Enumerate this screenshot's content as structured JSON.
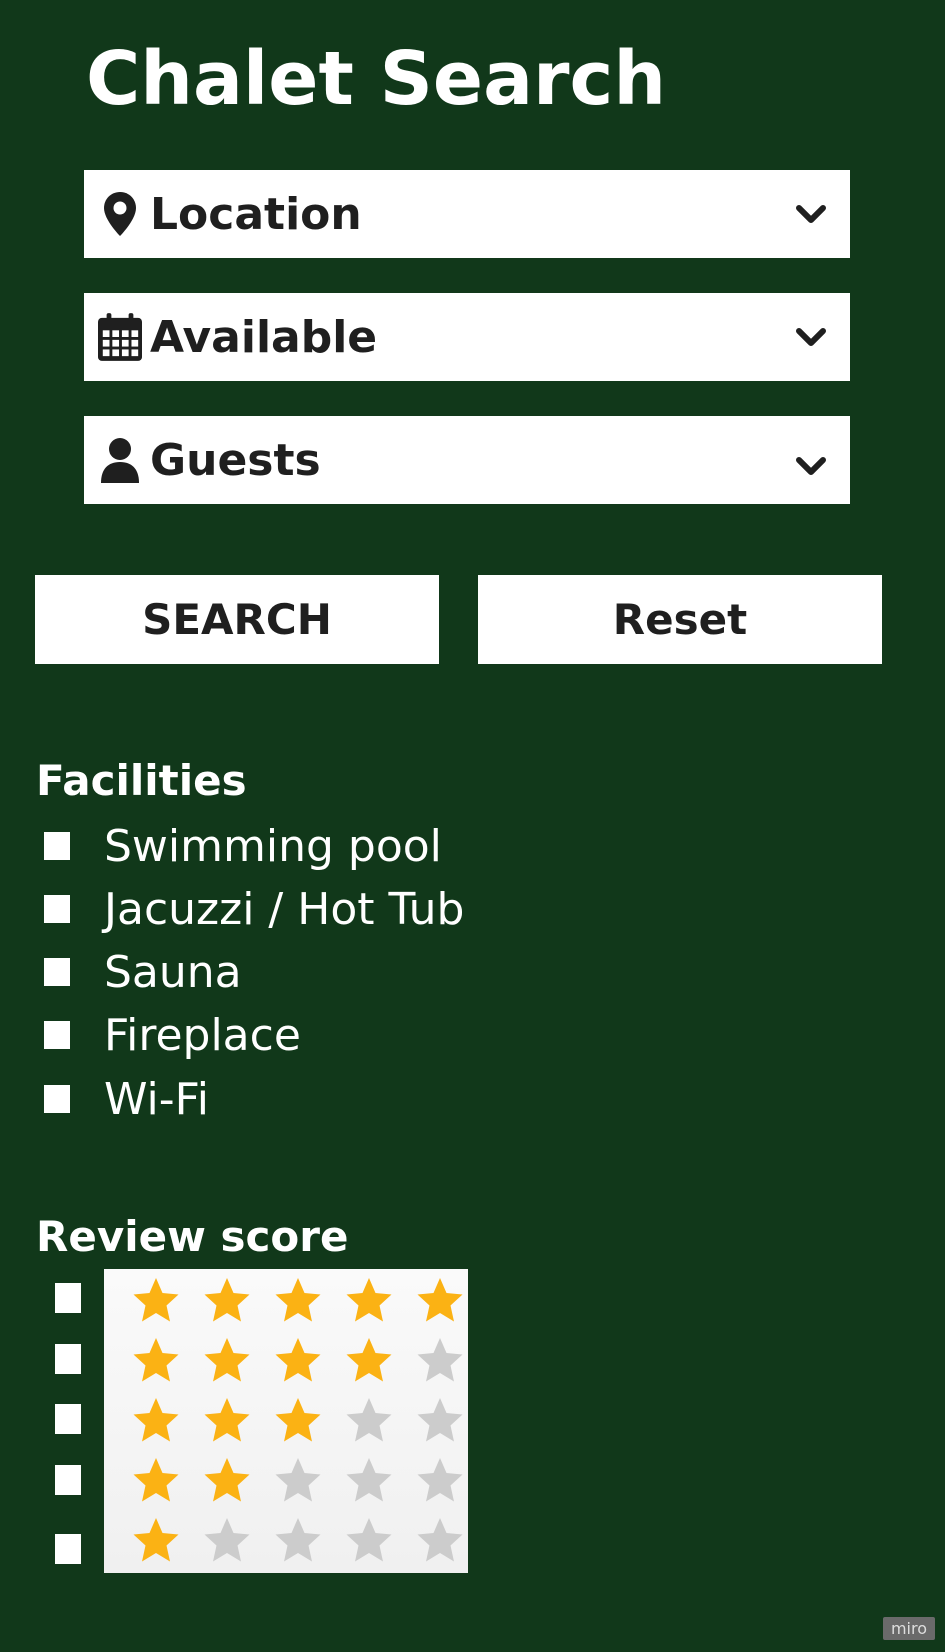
{
  "page": {
    "title": "Chalet Search"
  },
  "filters": {
    "location": {
      "label": "Location",
      "icon": "map-pin-icon"
    },
    "available": {
      "label": "Available",
      "icon": "calendar-icon"
    },
    "guests": {
      "label": "Guests",
      "icon": "person-icon"
    }
  },
  "actions": {
    "search_label": "SEARCH",
    "reset_label": "Reset"
  },
  "facilities": {
    "title": "Facilities",
    "items": [
      {
        "label": "Swimming pool",
        "checked": false
      },
      {
        "label": "Jacuzzi / Hot Tub",
        "checked": false
      },
      {
        "label": "Sauna",
        "checked": false
      },
      {
        "label": "Fireplace",
        "checked": false
      },
      {
        "label": "Wi-Fi",
        "checked": false
      }
    ]
  },
  "review": {
    "title": "Review score",
    "options": [
      {
        "stars": 5,
        "checked": false
      },
      {
        "stars": 4,
        "checked": false
      },
      {
        "stars": 3,
        "checked": false
      },
      {
        "stars": 2,
        "checked": false
      },
      {
        "stars": 1,
        "checked": false
      }
    ],
    "filled_color": "#fbb214",
    "empty_color": "#cccccc"
  },
  "badge": {
    "text": "miro"
  },
  "colors": {
    "background": "#11381a",
    "surface": "#ffffff",
    "text_dark": "#1f1f1f"
  }
}
